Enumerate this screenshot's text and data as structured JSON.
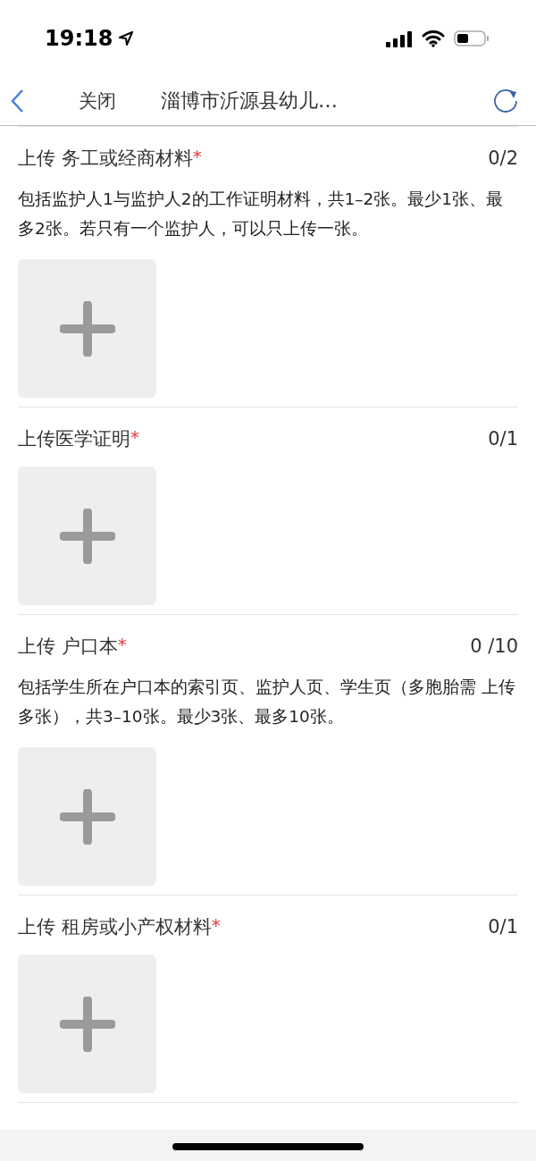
{
  "status_bar": {
    "time": "19:18"
  },
  "nav_bar": {
    "close_label": "关闭",
    "title": "淄博市沂源县幼儿…"
  },
  "sections": [
    {
      "title": "上传 务工或经商材料",
      "required_mark": "*",
      "count": "0/2",
      "description": "包括监护人1与监护人2的工作证明材料，共1–2张。最少1张、最多2张。若只有一个监护人，可以只上传一张。"
    },
    {
      "title": "上传医学证明",
      "required_mark": "*",
      "count": "0/1"
    },
    {
      "title": "上传 户口本",
      "required_mark": "*",
      "count": "0 /10",
      "description": "包括学生所在户口本的索引页、监护人页、学生页（多胞胎需 上传多张），共3–10张。最少3张、最多10张。"
    },
    {
      "title": "上传 租房或小产权材料",
      "required_mark": "*",
      "count": "0/1"
    }
  ]
}
